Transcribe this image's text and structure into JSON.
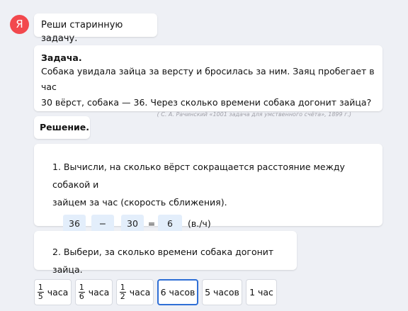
{
  "avatar": {
    "letter": "Я",
    "color": "#f2484d"
  },
  "prompt": "Реши старинную задачу.",
  "task": {
    "title": "Задача.",
    "line1": "Собака увидала зайца за версту и бросилась за ним. Заяц пробегает в час",
    "line2": "30 вёрст, собака — 36. Через сколько времени собака догонит зайца?",
    "source": "( С. А. Рачинский «1001 задача для умственного счёта», 1899 г.)"
  },
  "solution_label": "Решение.",
  "step1": {
    "line1": "1. Вычисли, на сколько вёрст сокращается расстояние между собакой и",
    "line2": "зайцем за час (скорость сближения).",
    "a": "36",
    "op": "−",
    "b": "30",
    "eq": "=",
    "result": "6",
    "unit": "(в./ч)"
  },
  "step2": {
    "text": "2. Выбери, за сколько времени собака догонит зайца."
  },
  "options": [
    {
      "num": "1",
      "den": "5",
      "label": "часа"
    },
    {
      "num": "1",
      "den": "6",
      "label": "часа"
    },
    {
      "num": "1",
      "den": "2",
      "label": "часа"
    },
    {
      "label": "6 часов",
      "selected": true
    },
    {
      "label": "5 часов"
    },
    {
      "label": "1 час"
    }
  ],
  "colors": {
    "background": "#eef0f5",
    "input_fill": "#e3eefb",
    "selected_border": "#2f6fd6"
  }
}
